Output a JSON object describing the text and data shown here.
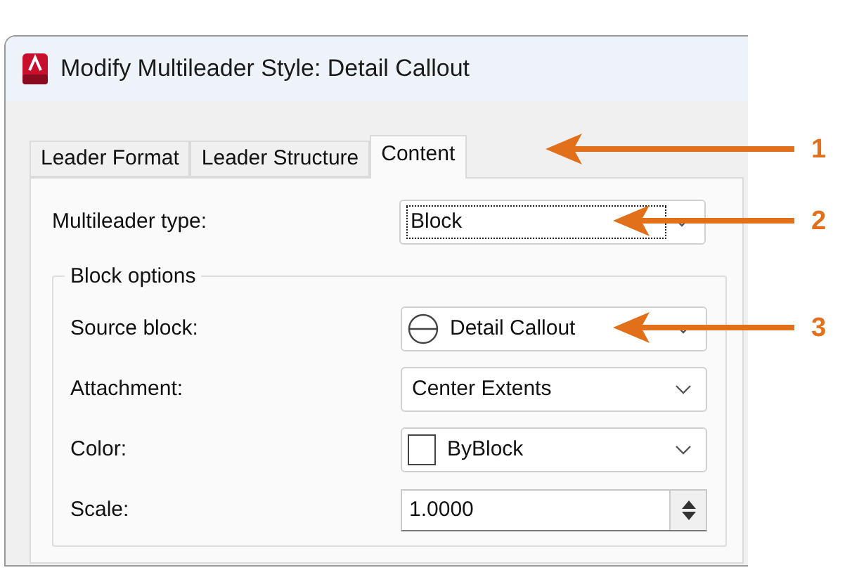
{
  "window": {
    "title": "Modify Multileader Style: Detail Callout"
  },
  "tabs": [
    {
      "label": "Leader Format",
      "selected": false
    },
    {
      "label": "Leader Structure",
      "selected": false
    },
    {
      "label": "Content",
      "selected": true
    }
  ],
  "fields": [
    {
      "label": "Multileader type:",
      "kind": "combo",
      "value": "Block",
      "focused": true
    }
  ],
  "group": {
    "title": "Block options",
    "fields": [
      {
        "label": "Source block:",
        "kind": "symbol-combo",
        "value": "Detail Callout"
      },
      {
        "label": "Attachment:",
        "kind": "combo",
        "value": "Center Extents"
      },
      {
        "label": "Color:",
        "kind": "swatch-combo",
        "value": "ByBlock"
      },
      {
        "label": "Scale:",
        "kind": "spinner",
        "value": "1.0000"
      }
    ]
  },
  "callouts": [
    {
      "number": "1"
    },
    {
      "number": "2"
    },
    {
      "number": "3"
    }
  ]
}
